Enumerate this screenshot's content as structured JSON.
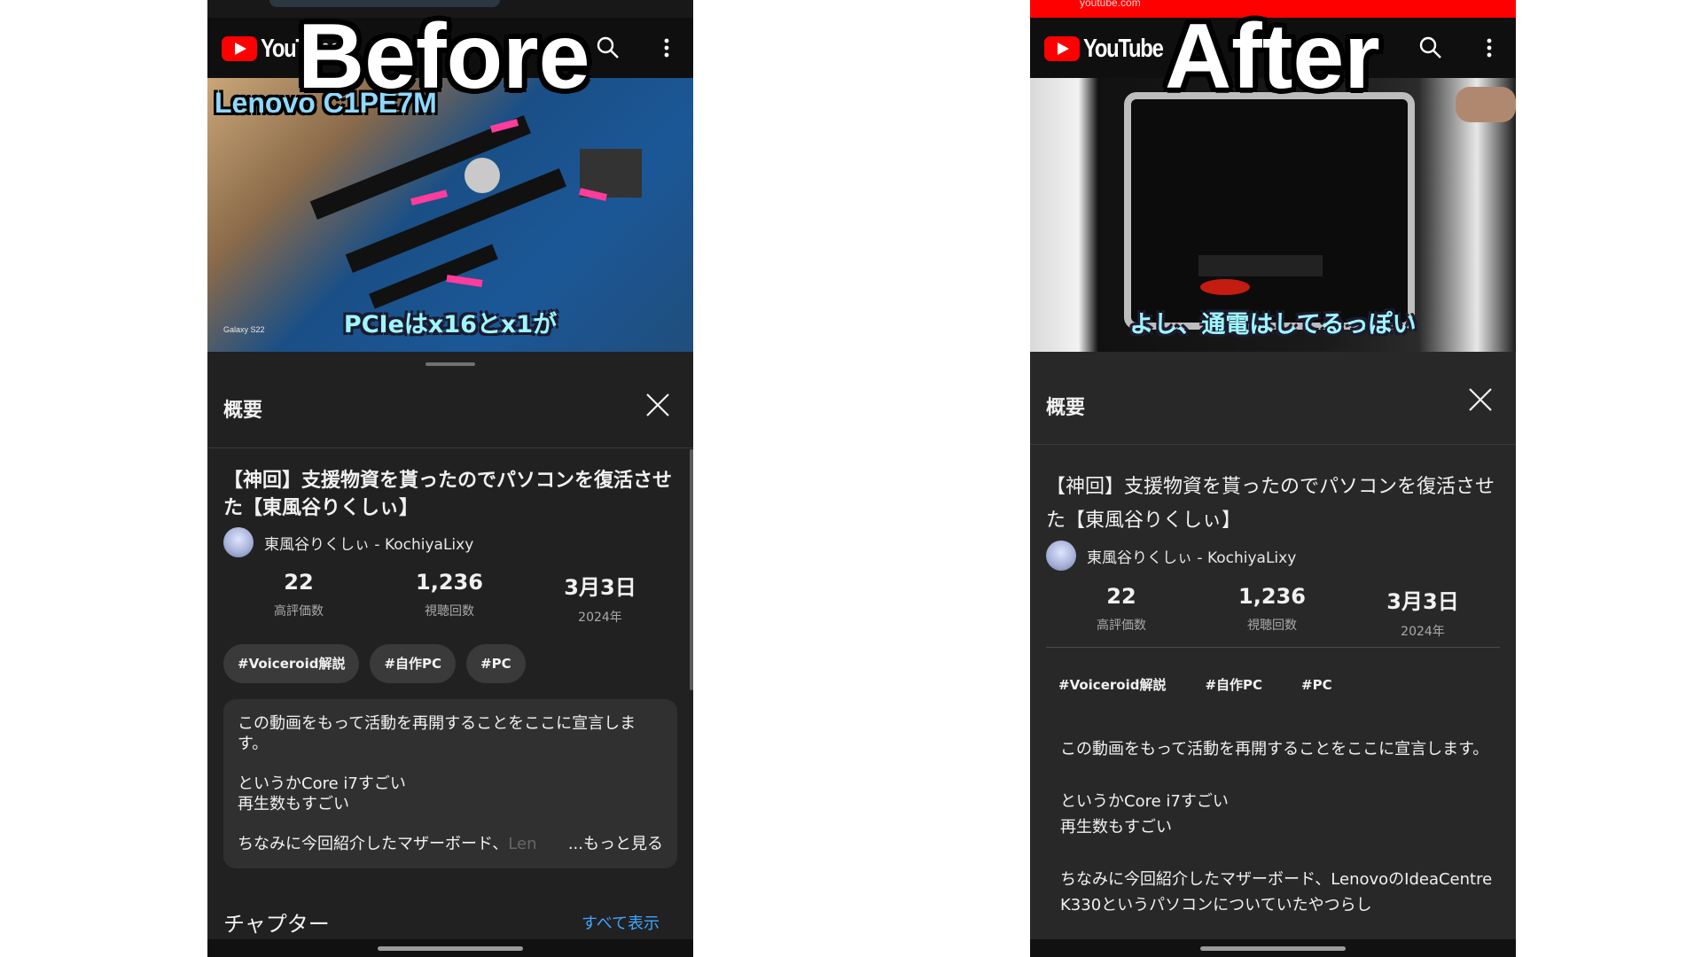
{
  "labels": {
    "before": "Before",
    "after": "After"
  },
  "before": {
    "header": {
      "logo_text": "YouTube"
    },
    "video": {
      "overlay_text": "Lenovo C1PE7M",
      "caption": "PCIeはx16とx1が",
      "watermark": "Galaxy S22"
    },
    "panel": {
      "title": "概要",
      "video_title": "【神回】支援物資を貰ったのでパソコンを復活させた【東風谷りくしぃ】",
      "channel": "東風谷りくしぃ - KochiyaLixy",
      "stats": [
        {
          "value": "22",
          "label": "高評価数"
        },
        {
          "value": "1,236",
          "label": "視聴回数"
        },
        {
          "value": "3月3日",
          "label": "2024年"
        }
      ],
      "tags": [
        "#Voiceroid解説",
        "#自作PC",
        "#PC"
      ],
      "description": [
        "この動画をもって活動を再開することをここに宣言します。",
        "というかCore i7すごい\n再生数もすごい"
      ],
      "description_last": "ちなみに今回紹介したマザーボード、",
      "description_fade": "Len",
      "more_label": "...もっと見る",
      "chapters_title": "チャプター",
      "chapters_link": "すべて表示"
    }
  },
  "after": {
    "status": {
      "url": "youtube.com"
    },
    "header": {
      "logo_text": "YouTube"
    },
    "video": {
      "caption": "よし、通電はしてるっぽい"
    },
    "panel": {
      "title": "概要",
      "video_title": "【神回】支援物資を貰ったのでパソコンを復活させた【東風谷りくしぃ】",
      "channel": "東風谷りくしぃ - KochiyaLixy",
      "stats": [
        {
          "value": "22",
          "label": "高評価数"
        },
        {
          "value": "1,236",
          "label": "視聴回数"
        },
        {
          "value": "3月3日",
          "label": "2024年"
        }
      ],
      "tags": [
        "#Voiceroid解説",
        "#自作PC",
        "#PC"
      ],
      "description": [
        "この動画をもって活動を再開することをここに宣言します。",
        "というかCore i7すごい\n再生数もすごい",
        "ちなみに今回紹介したマザーボード、LenovoのIdeaCentre K330というパソコンについていたやつらし"
      ]
    }
  }
}
